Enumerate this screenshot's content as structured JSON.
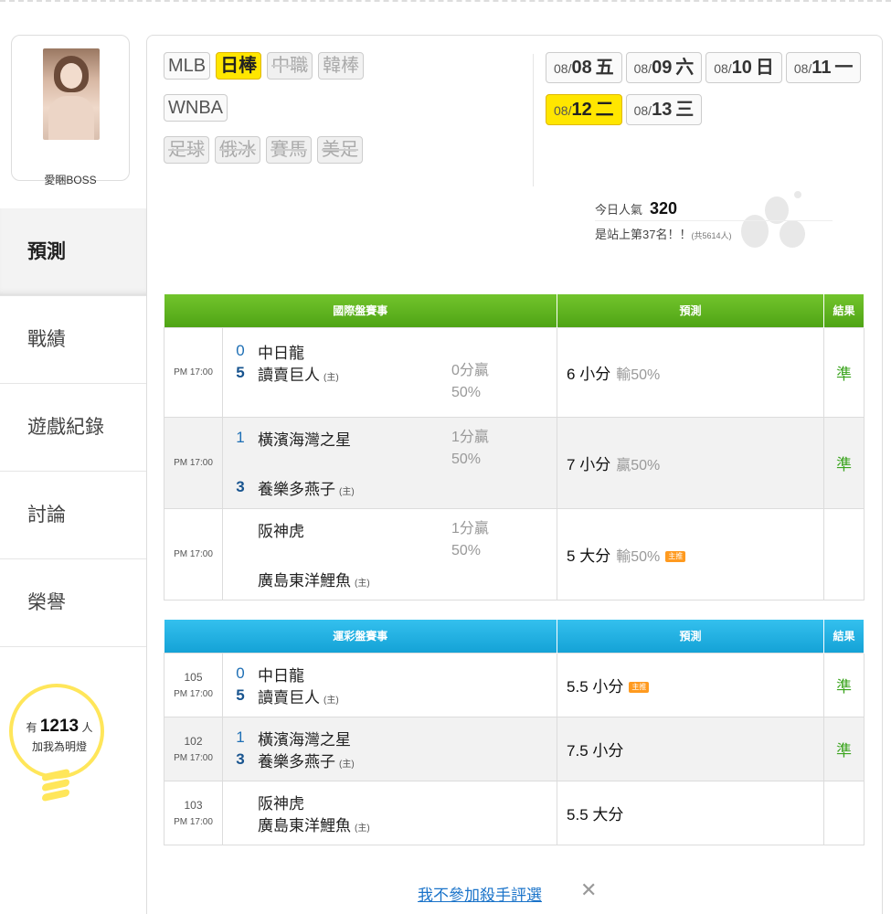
{
  "user": {
    "name": "愛睏BOSS"
  },
  "nav": [
    "預測",
    "戰績",
    "遊戲紀錄",
    "討論",
    "榮譽"
  ],
  "fans": {
    "prefix": "有",
    "count": "1213",
    "unit": "人",
    "line2": "加我為明燈"
  },
  "leagues": {
    "row1": [
      "MLB",
      "日棒",
      "中職",
      "韓棒"
    ],
    "row2": [
      "WNBA"
    ],
    "row3": [
      "足球",
      "俄冰",
      "賽馬",
      "美足"
    ]
  },
  "dates": [
    {
      "md": "08/",
      "day": "08",
      "wd": "五"
    },
    {
      "md": "08/",
      "day": "09",
      "wd": "六"
    },
    {
      "md": "08/",
      "day": "10",
      "wd": "日"
    },
    {
      "md": "08/",
      "day": "11",
      "wd": "一"
    },
    {
      "md": "08/",
      "day": "12",
      "wd": "二"
    },
    {
      "md": "08/",
      "day": "13",
      "wd": "三"
    }
  ],
  "popularity": {
    "label": "今日人氣",
    "value": "320",
    "rank_text": "是站上第37名！！",
    "total": "(共5614人)"
  },
  "intl_table": {
    "headers": [
      "國際盤賽事",
      "預測",
      "結果"
    ],
    "rows": [
      {
        "time": "PM 17:00",
        "s1": "0",
        "s2": "5",
        "team1": "中日龍",
        "team2": "讀賣巨人",
        "home": "(主)",
        "hcap1": "0分贏",
        "hcap2": "50%",
        "pred": "6 小分",
        "pct": "輸50%",
        "result": "準"
      },
      {
        "time": "PM 17:00",
        "s1": "1",
        "s2": "3",
        "team1": "橫濱海灣之星",
        "team2": "養樂多燕子",
        "home": "(主)",
        "hcap1": "1分贏",
        "hcap2": "50%",
        "pred": "7 小分",
        "pct": "贏50%",
        "result": "準"
      },
      {
        "time": "PM 17:00",
        "s1": "",
        "s2": "",
        "team1": "阪神虎",
        "team2": "廣島東洋鯉魚",
        "home": "(主)",
        "hcap1": "1分贏",
        "hcap2": "50%",
        "pred": "5 大分",
        "pct": "輸50%",
        "tag": "主推",
        "result": ""
      }
    ]
  },
  "lottery_table": {
    "headers": [
      "運彩盤賽事",
      "預測",
      "結果"
    ],
    "rows": [
      {
        "num": "105",
        "time": "PM 17:00",
        "s1": "0",
        "s2": "5",
        "team1": "中日龍",
        "team2": "讀賣巨人",
        "home": "(主)",
        "pred": "5.5 小分",
        "tag": "主推",
        "result": "準"
      },
      {
        "num": "102",
        "time": "PM 17:00",
        "s1": "1",
        "s2": "3",
        "team1": "橫濱海灣之星",
        "team2": "養樂多燕子",
        "home": "(主)",
        "pred": "7.5 小分",
        "result": "準"
      },
      {
        "num": "103",
        "time": "PM 17:00",
        "s1": "",
        "s2": "",
        "team1": "阪神虎",
        "team2": "廣島東洋鯉魚",
        "home": "(主)",
        "pred": "5.5 大分",
        "result": ""
      }
    ]
  },
  "footer": {
    "link": "我不參加殺手評選",
    "close": "✕"
  },
  "colors": {
    "green_header": "#5ab31c",
    "blue_header": "#1eaee0",
    "highlight": "#ffe600",
    "win": "#3ba41e",
    "score": "#1e6fb5"
  }
}
